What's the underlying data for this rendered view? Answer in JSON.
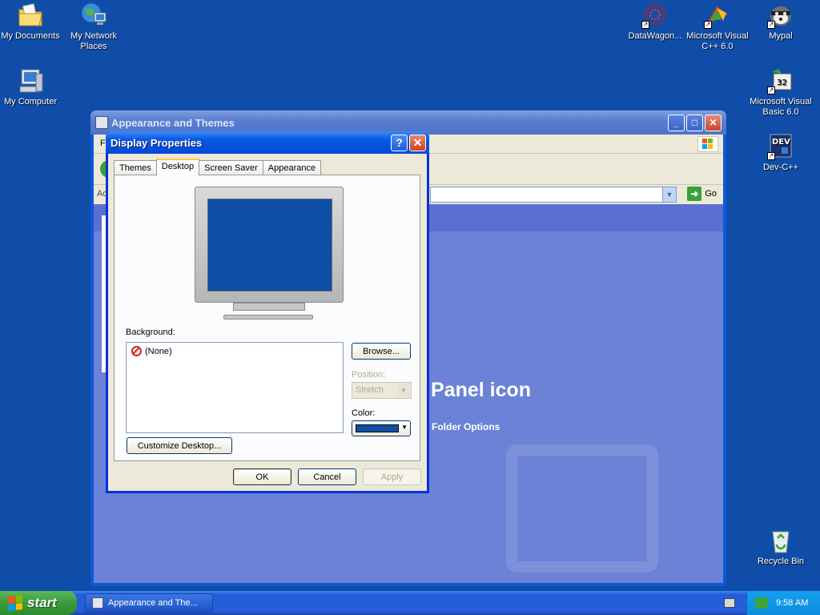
{
  "desktop": {
    "icons": [
      {
        "label": "My Documents",
        "icon": "folder-documents-icon",
        "shortcut": false
      },
      {
        "label": "My Network Places",
        "icon": "network-places-icon",
        "shortcut": false
      },
      {
        "label": "My Computer",
        "icon": "computer-icon",
        "shortcut": false
      },
      {
        "label": "DataWagon...",
        "icon": "datawagon-icon",
        "shortcut": true
      },
      {
        "label": "Microsoft Visual C++ 6.0",
        "icon": "visual-cpp-icon",
        "shortcut": true
      },
      {
        "label": "Mypal",
        "icon": "mypal-icon",
        "shortcut": true
      },
      {
        "label": "Microsoft Visual Basic 6.0",
        "icon": "visual-basic-icon",
        "shortcut": true
      },
      {
        "label": "Dev-C++",
        "icon": "devcpp-icon",
        "shortcut": true
      },
      {
        "label": "Recycle Bin",
        "icon": "recycle-bin-icon",
        "shortcut": false
      }
    ],
    "background_color": "#0f4da8"
  },
  "appearance_window": {
    "title": "Appearance and Themes",
    "menu_first_letter": "F",
    "addr_label_prefix": "Ac",
    "go_label": "Go",
    "heading": "Panel icon",
    "link": "Folder Options"
  },
  "dialog": {
    "title": "Display Properties",
    "help_button": "?",
    "close_button": "✕",
    "tabs": [
      "Themes",
      "Desktop",
      "Screen Saver",
      "Appearance"
    ],
    "active_tab": "Desktop",
    "background_label": "Background:",
    "background_items": [
      "(None)"
    ],
    "browse_button": "Browse...",
    "position_label": "Position:",
    "position_value": "Stretch",
    "color_label": "Color:",
    "color_value": "#0d4ea6",
    "customize_button": "Customize Desktop...",
    "ok_button": "OK",
    "cancel_button": "Cancel",
    "apply_button": "Apply"
  },
  "taskbar": {
    "start_label": "start",
    "task_label": "Appearance and The...",
    "clock": "9:58 AM"
  }
}
